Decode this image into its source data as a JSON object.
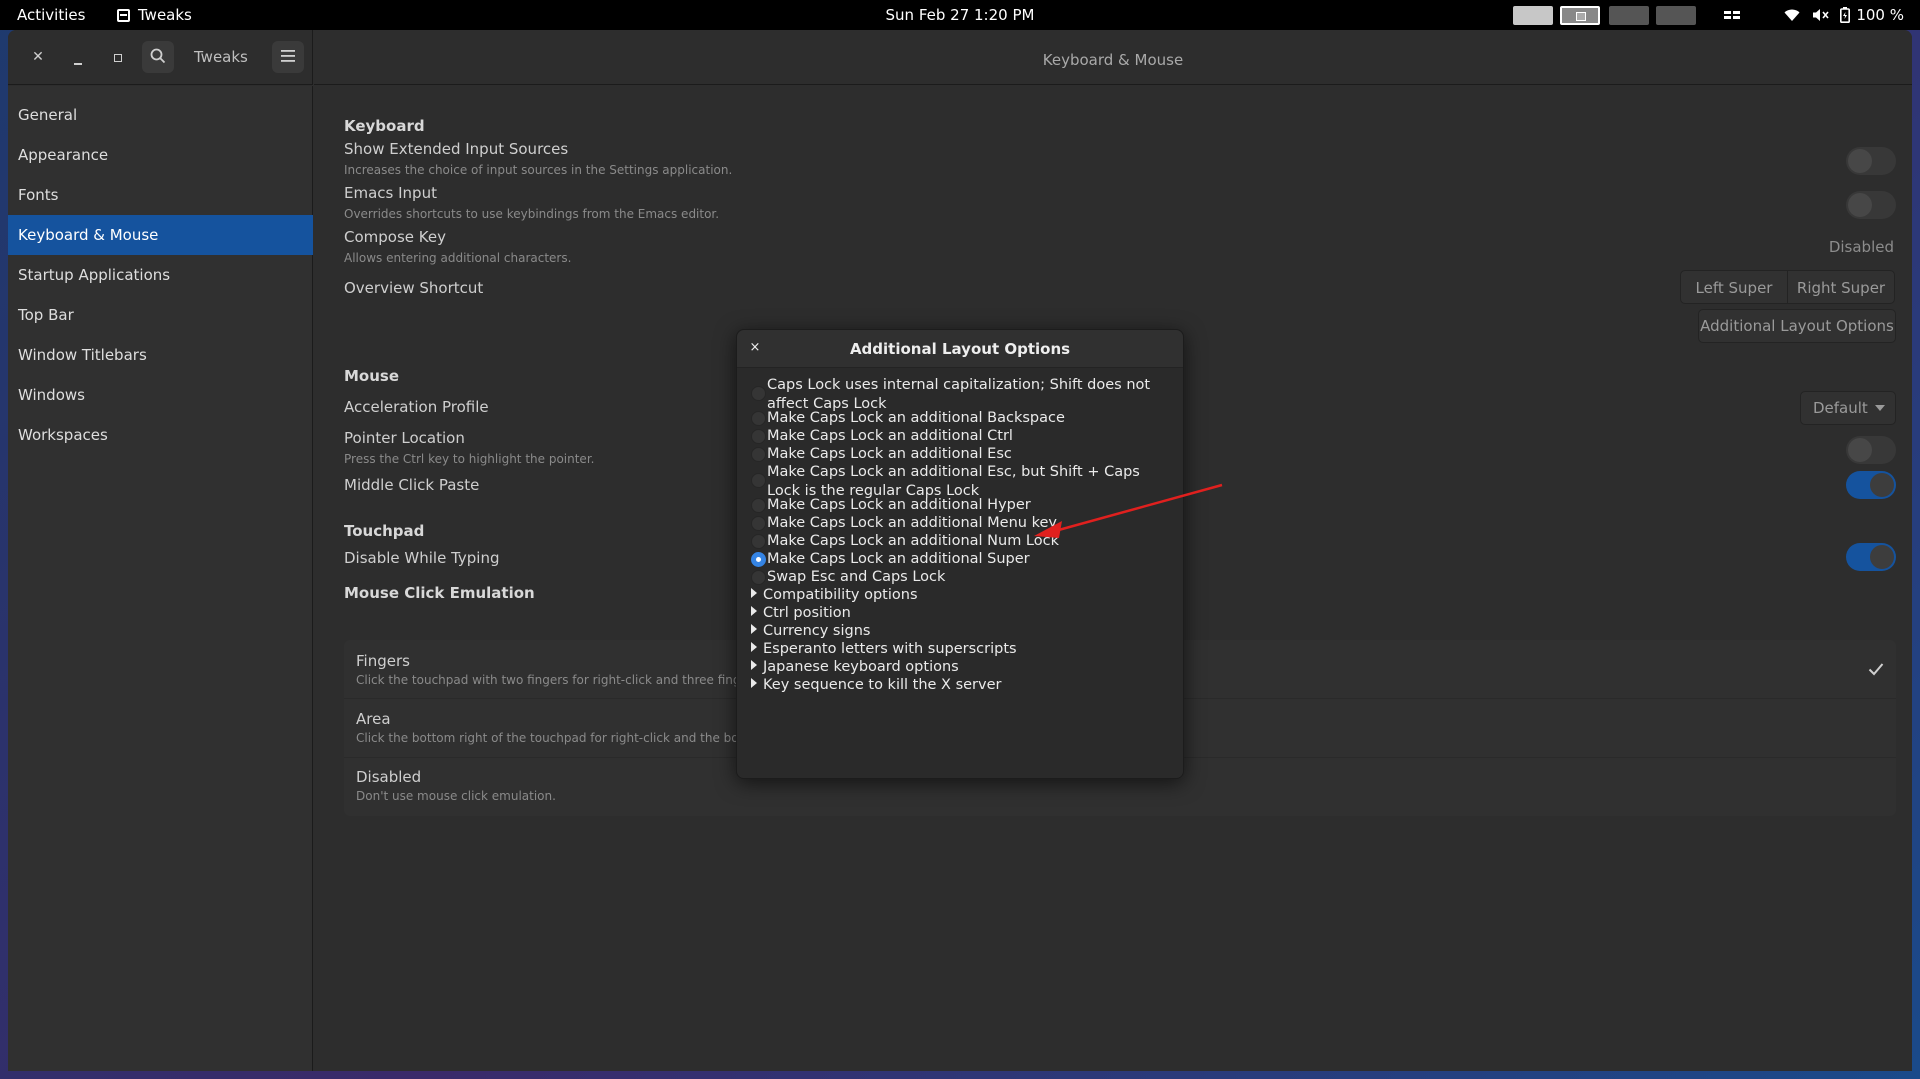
{
  "topbar": {
    "activities": "Activities",
    "app_name": "Tweaks",
    "clock": "Sun Feb 27  1:20 PM",
    "battery": "100 %"
  },
  "window": {
    "sidebar_title": "Tweaks",
    "page_title": "Keyboard & Mouse"
  },
  "sidebar": {
    "items": [
      "General",
      "Appearance",
      "Fonts",
      "Keyboard & Mouse",
      "Startup Applications",
      "Top Bar",
      "Window Titlebars",
      "Windows",
      "Workspaces"
    ],
    "selected": "Keyboard & Mouse"
  },
  "keyboard": {
    "section": "Keyboard",
    "extended_title": "Show Extended Input Sources",
    "extended_sub": "Increases the choice of input sources in the Settings application.",
    "emacs_title": "Emacs Input",
    "emacs_sub": "Overrides shortcuts to use keybindings from the Emacs editor.",
    "compose_title": "Compose Key",
    "compose_sub": "Allows entering additional characters.",
    "compose_value": "Disabled",
    "overview_title": "Overview Shortcut",
    "left_super": "Left Super",
    "right_super": "Right Super",
    "additional_layout": "Additional Layout Options"
  },
  "mouse": {
    "section": "Mouse",
    "accel_title": "Acceleration Profile",
    "accel_value": "Default",
    "pointer_title": "Pointer Location",
    "pointer_sub": "Press the Ctrl key to highlight the pointer.",
    "middle_title": "Middle Click Paste"
  },
  "touchpad": {
    "section": "Touchpad",
    "disable_typing": "Disable While Typing"
  },
  "emulation": {
    "section": "Mouse Click Emulation",
    "fingers_title": "Fingers",
    "fingers_sub": "Click the touchpad with two fingers for right-click and three fingers for",
    "area_title": "Area",
    "area_sub": "Click the bottom right of the touchpad for right-click and the bottom mi",
    "disabled_title": "Disabled",
    "disabled_sub": "Don't use mouse click emulation."
  },
  "dialog": {
    "title": "Additional Layout Options",
    "close": "×",
    "options": [
      {
        "label": "Caps Lock uses internal capitalization; Shift does not affect Caps Lock",
        "checked": false
      },
      {
        "label": "Make Caps Lock an additional Backspace",
        "checked": false
      },
      {
        "label": "Make Caps Lock an additional Ctrl",
        "checked": false
      },
      {
        "label": "Make Caps Lock an additional Esc",
        "checked": false
      },
      {
        "label": "Make Caps Lock an additional Esc, but Shift + Caps Lock is the regular Caps Lock",
        "checked": false
      },
      {
        "label": "Make Caps Lock an additional Hyper",
        "checked": false
      },
      {
        "label": "Make Caps Lock an additional Menu key",
        "checked": false
      },
      {
        "label": "Make Caps Lock an additional Num Lock",
        "checked": false
      },
      {
        "label": "Make Caps Lock an additional Super",
        "checked": true
      },
      {
        "label": "Swap Esc and Caps Lock",
        "checked": false
      }
    ],
    "expanders": [
      "Compatibility options",
      "Ctrl position",
      "Currency signs",
      "Esperanto letters with superscripts",
      "Japanese keyboard options",
      "Key sequence to kill the X server"
    ]
  },
  "colors": {
    "accent": "#15539e",
    "radio_checked": "#3584e4",
    "annotation_arrow": "#e0201e"
  }
}
